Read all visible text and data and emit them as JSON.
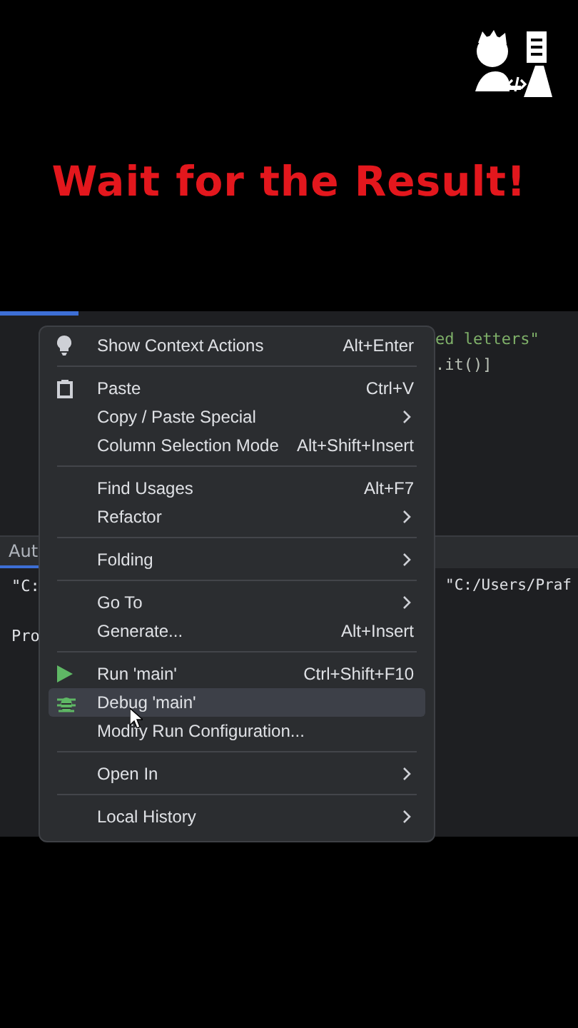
{
  "title": "Wait for the Result!",
  "editor": {
    "lines": [
      {
        "text": "ed letters\""
      },
      {
        "text": ".it()]"
      }
    ]
  },
  "tool_window": {
    "tab": {
      "label": "Aut",
      "selected": true
    },
    "lines": [
      {
        "left": "\"C:",
        "right": "\"C:/Users/Praf"
      },
      {
        "left": "Pro"
      }
    ]
  },
  "context_menu": {
    "groups": [
      {
        "items": [
          {
            "label": "Show Context Actions",
            "shortcut": "Alt+Enter",
            "submenu": false,
            "selected": false
          }
        ]
      },
      {
        "items": [
          {
            "label": "Paste",
            "shortcut": "Ctrl+V",
            "submenu": false,
            "selected": false
          },
          {
            "label": "Copy / Paste Special",
            "submenu": true,
            "selected": false
          },
          {
            "label": "Column Selection Mode",
            "shortcut": "Alt+Shift+Insert",
            "submenu": false,
            "selected": false
          }
        ]
      },
      {
        "items": [
          {
            "label": "Find Usages",
            "shortcut": "Alt+F7",
            "submenu": false,
            "selected": false
          },
          {
            "label": "Refactor",
            "submenu": true,
            "selected": false
          }
        ]
      },
      {
        "items": [
          {
            "label": "Folding",
            "submenu": true,
            "selected": false
          }
        ]
      },
      {
        "items": [
          {
            "label": "Go To",
            "submenu": true,
            "selected": false
          },
          {
            "label": "Generate...",
            "shortcut": "Alt+Insert",
            "submenu": false,
            "selected": false
          }
        ]
      },
      {
        "items": [
          {
            "label": "Run 'main'",
            "shortcut": "Ctrl+Shift+F10",
            "submenu": false,
            "selected": false
          },
          {
            "label": "Debug 'main'",
            "submenu": false,
            "selected": true
          },
          {
            "label": "Modify Run Configuration...",
            "submenu": false,
            "selected": false
          }
        ]
      },
      {
        "items": [
          {
            "label": "Open In",
            "submenu": true,
            "selected": false
          }
        ]
      },
      {
        "items": [
          {
            "label": "Local History",
            "submenu": true,
            "selected": false
          }
        ]
      }
    ]
  }
}
